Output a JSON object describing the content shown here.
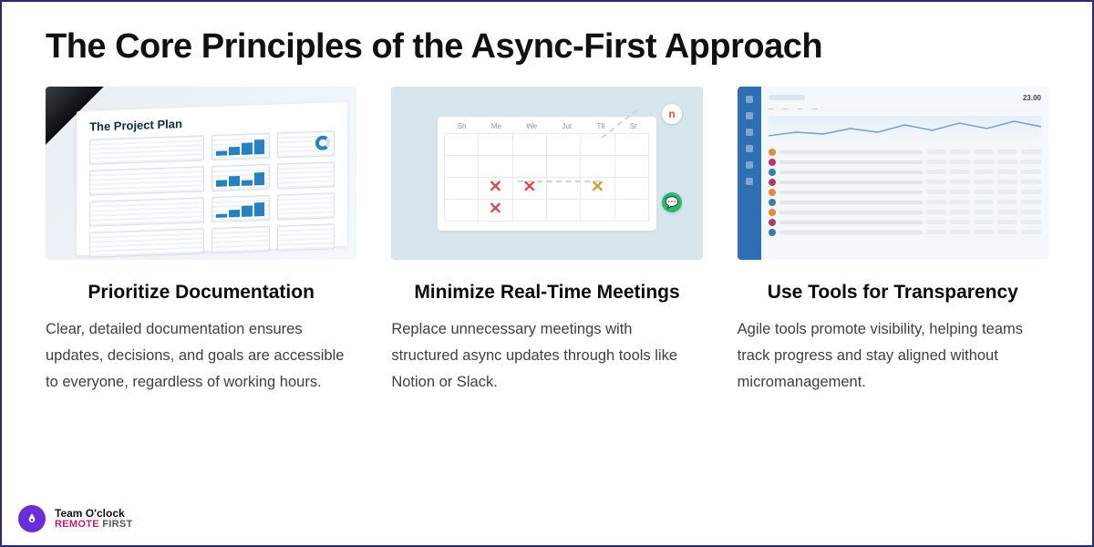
{
  "title": "The Core Principles of the Async-First Approach",
  "cards": [
    {
      "title": "Prioritize Documentation",
      "body": "Clear, detailed documentation ensures updates, decisions, and goals are accessible to everyone, regardless of working hours.",
      "illus_label": "The Project Plan"
    },
    {
      "title": "Minimize Real-Time Meetings",
      "body": "Replace unnecessary meetings with structured async updates through tools like Notion or Slack.",
      "cal_days": [
        "Sh",
        "Me",
        "We",
        "Jut",
        "Tfi",
        "St"
      ]
    },
    {
      "title": "Use Tools for Transparency",
      "body": "Agile tools promote visibility, helping teams track progress and stay aligned without micromanagement.",
      "dash_price": "23.00"
    }
  ],
  "footer": {
    "brand": "Team O'clock",
    "tag_a": "REMOTE",
    "tag_b": " FIRST"
  }
}
